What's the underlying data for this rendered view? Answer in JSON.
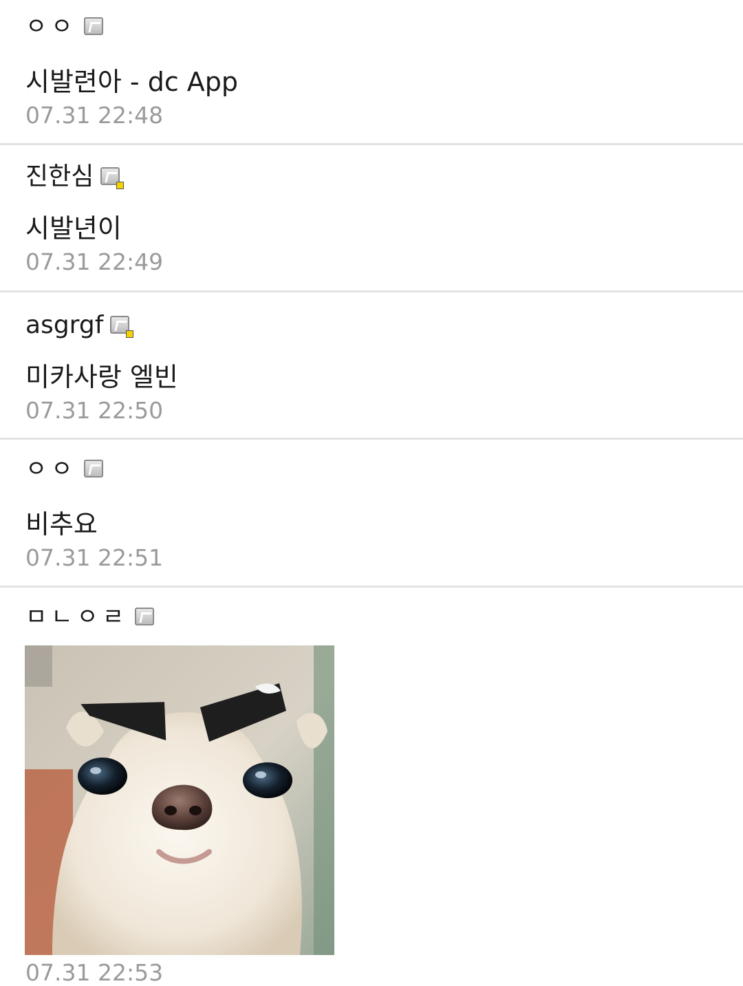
{
  "comments": [
    {
      "nickname": "ㅇㅇ",
      "icon": "gonick-icon",
      "memo": "시발련아 - dc App",
      "date": "07.31 22:48"
    },
    {
      "nickname": "진한심",
      "icon": "gonick-icon-yellow",
      "memo": "시발년이",
      "date": "07.31 22:49"
    },
    {
      "nickname": "asgrgf",
      "icon": "gonick-icon-yellow",
      "memo": "미카사랑 엘빈",
      "date": "07.31 22:50"
    },
    {
      "nickname": "ㅇㅇ",
      "icon": "gonick-icon",
      "memo": "비추요",
      "date": "07.31 22:51"
    },
    {
      "nickname": "ㅁㄴㅇㄹ",
      "icon": "gonick-icon",
      "image": "chihuahua-with-eyebrows",
      "date": "07.31 22:53"
    }
  ],
  "colors": {
    "divider": "#e2e2e2",
    "date": "#9a9a9a",
    "text": "#1a1a1a"
  }
}
